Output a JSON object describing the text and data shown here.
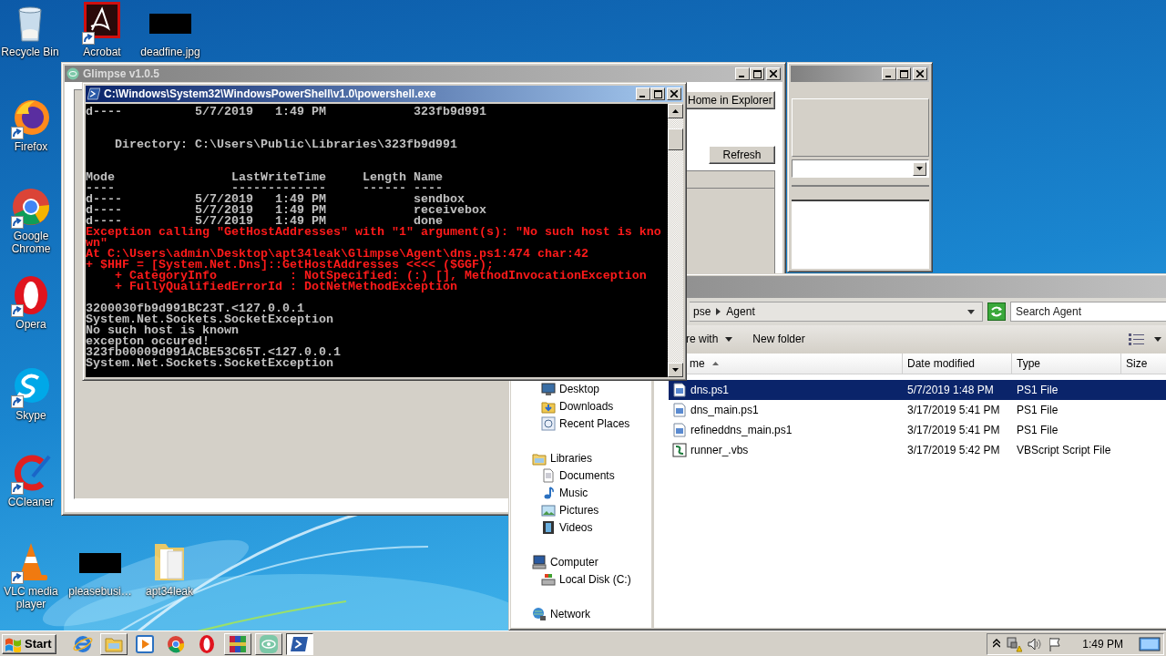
{
  "desktop": {
    "icons": [
      {
        "label": "Recycle Bin",
        "kind": "bin",
        "shortcut": false
      },
      {
        "label": "Acrobat",
        "kind": "pdf",
        "shortcut": true
      },
      {
        "label": "deadfine.jpg",
        "kind": "redacted",
        "shortcut": false
      },
      {
        "label": "Firefox",
        "kind": "firefox",
        "shortcut": true
      },
      {
        "label": "Google Chrome",
        "kind": "chrome",
        "shortcut": true
      },
      {
        "label": "Opera",
        "kind": "opera",
        "shortcut": true
      },
      {
        "label": "Skype",
        "kind": "skype",
        "shortcut": true
      },
      {
        "label": "CCleaner",
        "kind": "ccleaner",
        "shortcut": true
      },
      {
        "label": "VLC media player",
        "kind": "vlc",
        "shortcut": true
      },
      {
        "label": "pleasebusi…",
        "kind": "redacted",
        "shortcut": false
      },
      {
        "label": "apt34leak",
        "kind": "folder",
        "shortcut": false
      }
    ]
  },
  "glimpse_window": {
    "title": "Glimpse v1.0.5",
    "active": false,
    "buttons": [
      "Home in Explorer",
      "Refresh"
    ]
  },
  "second_window": {
    "active": false
  },
  "explorer": {
    "active": false,
    "breadcrumb": [
      "pse",
      "Agent"
    ],
    "search": {
      "placeholder": "Search Agent"
    },
    "toolbar": [
      {
        "label": "re with",
        "kind": "menu"
      },
      {
        "label": "New folder",
        "kind": "button"
      }
    ],
    "columns": [
      {
        "label": "me",
        "sorted": true
      },
      {
        "label": "Date modified",
        "sorted": false
      },
      {
        "label": "Type",
        "sorted": false
      },
      {
        "label": "Size",
        "sorted": false
      }
    ],
    "nav_pane": {
      "groups": [
        {
          "children": [
            {
              "label": "Desktop",
              "kind": "desktop"
            },
            {
              "label": "Downloads",
              "kind": "downloads"
            },
            {
              "label": "Recent Places",
              "kind": "recent"
            }
          ]
        },
        {
          "label": "Libraries",
          "kind": "libraries",
          "children": [
            {
              "label": "Documents",
              "kind": "documents"
            },
            {
              "label": "Music",
              "kind": "music"
            },
            {
              "label": "Pictures",
              "kind": "pictures"
            },
            {
              "label": "Videos",
              "kind": "videos"
            }
          ]
        },
        {
          "label": "Computer",
          "kind": "computer",
          "children": [
            {
              "label": "Local Disk (C:)",
              "kind": "disk"
            }
          ]
        },
        {
          "label": "Network",
          "kind": "network"
        }
      ]
    },
    "files": [
      {
        "name": "dns.ps1",
        "date_modified": "5/7/2019 1:48 PM",
        "type": "PS1 File",
        "kind": "ps1",
        "selected": true
      },
      {
        "name": "dns_main.ps1",
        "date_modified": "3/17/2019 5:41 PM",
        "type": "PS1 File",
        "kind": "ps1",
        "selected": false
      },
      {
        "name": "refineddns_main.ps1",
        "date_modified": "3/17/2019 5:41 PM",
        "type": "PS1 File",
        "kind": "ps1",
        "selected": false
      },
      {
        "name": "runner_.vbs",
        "date_modified": "3/17/2019 5:42 PM",
        "type": "VBScript Script File",
        "kind": "vbs",
        "selected": false
      }
    ]
  },
  "powershell": {
    "title": "C:\\Windows\\System32\\WindowsPowerShell\\v1.0\\powershell.exe",
    "active": true,
    "lines": [
      {
        "kind": "output",
        "text": "d----          5/7/2019   1:49 PM            323fb9d991"
      },
      {
        "kind": "blank"
      },
      {
        "kind": "blank"
      },
      {
        "kind": "output",
        "text": "    Directory: C:\\Users\\Public\\Libraries\\323fb9d991"
      },
      {
        "kind": "blank"
      },
      {
        "kind": "blank"
      },
      {
        "kind": "output",
        "text": "Mode                LastWriteTime     Length Name"
      },
      {
        "kind": "output",
        "text": "----                -------------     ------ ----"
      },
      {
        "kind": "output",
        "text": "d----          5/7/2019   1:49 PM            sendbox"
      },
      {
        "kind": "output",
        "text": "d----          5/7/2019   1:49 PM            receivebox"
      },
      {
        "kind": "output",
        "text": "d----          5/7/2019   1:49 PM            done"
      },
      {
        "kind": "error",
        "text": "Exception calling \"GetHostAddresses\" with \"1\" argument(s): \"No such host is kno"
      },
      {
        "kind": "error",
        "text": "wn\""
      },
      {
        "kind": "error",
        "text": "At C:\\Users\\admin\\Desktop\\apt34leak\\Glimpse\\Agent\\dns.ps1:474 char:42"
      },
      {
        "kind": "error",
        "text": "+ $HHF = [System.Net.Dns]::GetHostAddresses <<<< ($GGF);"
      },
      {
        "kind": "error",
        "text": "    + CategoryInfo          : NotSpecified: (:) [], MethodInvocationException"
      },
      {
        "kind": "error",
        "text": "    + FullyQualifiedErrorId : DotNetMethodException"
      },
      {
        "kind": "blank"
      },
      {
        "kind": "output",
        "text": "3200030fb9d991BC23T.<127.0.0.1"
      },
      {
        "kind": "output",
        "text": "System.Net.Sockets.SocketException"
      },
      {
        "kind": "output",
        "text": "No such host is known"
      },
      {
        "kind": "output",
        "text": "excepton occured!"
      },
      {
        "kind": "output",
        "text": "323fb00009d991ACBE53C65T.<127.0.0.1"
      },
      {
        "kind": "output",
        "text": "System.Net.Sockets.SocketException"
      }
    ]
  },
  "taskbar": {
    "start": "Start",
    "items": [
      {
        "kind": "ie",
        "open": false,
        "selected": false
      },
      {
        "kind": "explorer",
        "open": true,
        "selected": false
      },
      {
        "kind": "media",
        "open": false,
        "selected": false
      },
      {
        "kind": "chrome",
        "open": false,
        "selected": false
      },
      {
        "kind": "opera",
        "open": false,
        "selected": false
      },
      {
        "kind": "winrar",
        "open": true,
        "selected": false
      },
      {
        "kind": "glimpse",
        "open": true,
        "selected": false
      },
      {
        "kind": "powershell",
        "open": true,
        "selected": true
      }
    ],
    "clock": "1:49 PM"
  }
}
